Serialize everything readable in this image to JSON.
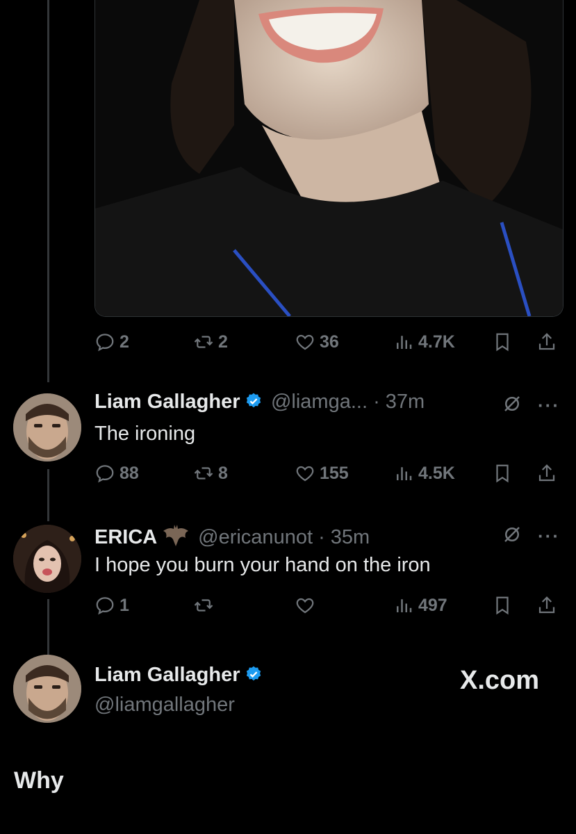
{
  "first_post": {
    "actions": {
      "replies": "2",
      "reposts": "2",
      "likes": "36",
      "views": "4.7K"
    }
  },
  "reply_1": {
    "name": "Liam Gallagher",
    "handle": "@liamga...",
    "time": "37m",
    "text": "The ironing",
    "actions": {
      "replies": "88",
      "reposts": "8",
      "likes": "155",
      "views": "4.5K"
    }
  },
  "reply_2": {
    "name": "ERICA",
    "handle": "@ericanunot",
    "time": "35m",
    "text": "I hope you burn your hand on the iron",
    "actions": {
      "replies": "1",
      "reposts": "",
      "likes": "",
      "views": "497"
    }
  },
  "profile_card": {
    "name": "Liam Gallagher",
    "handle": "@liamgallagher",
    "brand": "X.com"
  },
  "caption": "Why",
  "colors": {
    "background": "#000000",
    "muted": "#71767b",
    "verified": "#1d9bf0"
  }
}
